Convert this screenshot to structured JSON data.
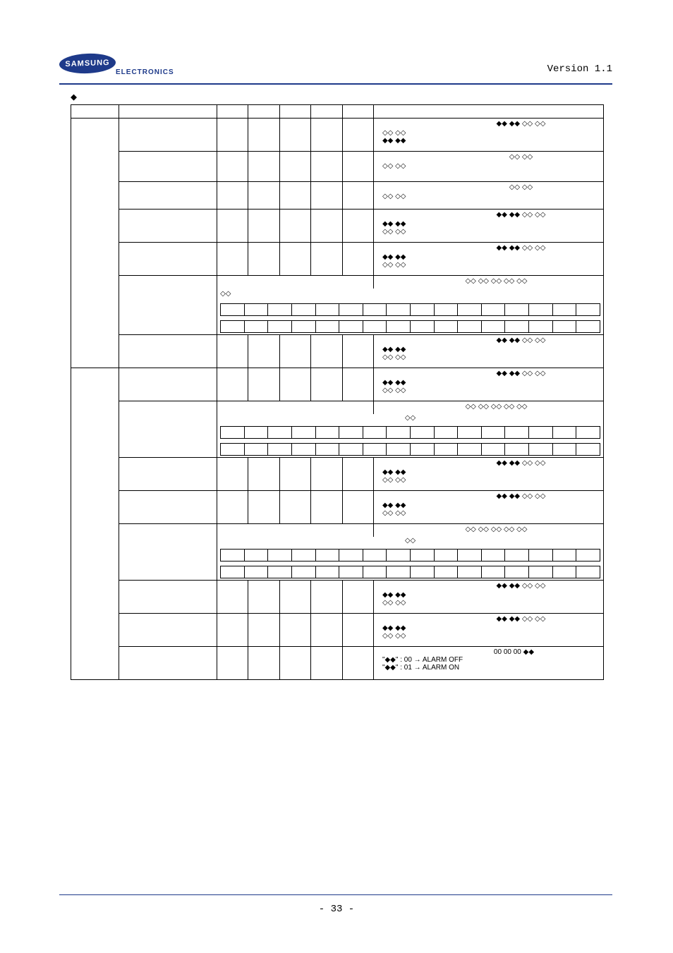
{
  "header": {
    "brand": "SAMSUNG",
    "sub_brand": "ELECTRONICS",
    "version": "Version 1.1"
  },
  "footer": {
    "page_number": "- 33 -"
  },
  "section_bullet": "◆",
  "symbols": {
    "filled_pair": "◆◆ ◆◆",
    "empty_pair": "◇◇ ◇◇",
    "filled_empty_line": "◆◆ ◆◆ ◇◇ ◇◇",
    "empty_line_2": "◇◇ ◇◇",
    "empty_line_5": "◇◇ ◇◇ ◇◇ ◇◇ ◇◇",
    "single_empty_pair": "◇◇"
  },
  "desc_alarm": {
    "top": "00 00 00 ◆◆",
    "line1": "\"◆◆\" : 00 → ALARM OFF",
    "line2": "\"◆◆\" : 01 → ALARM ON"
  }
}
